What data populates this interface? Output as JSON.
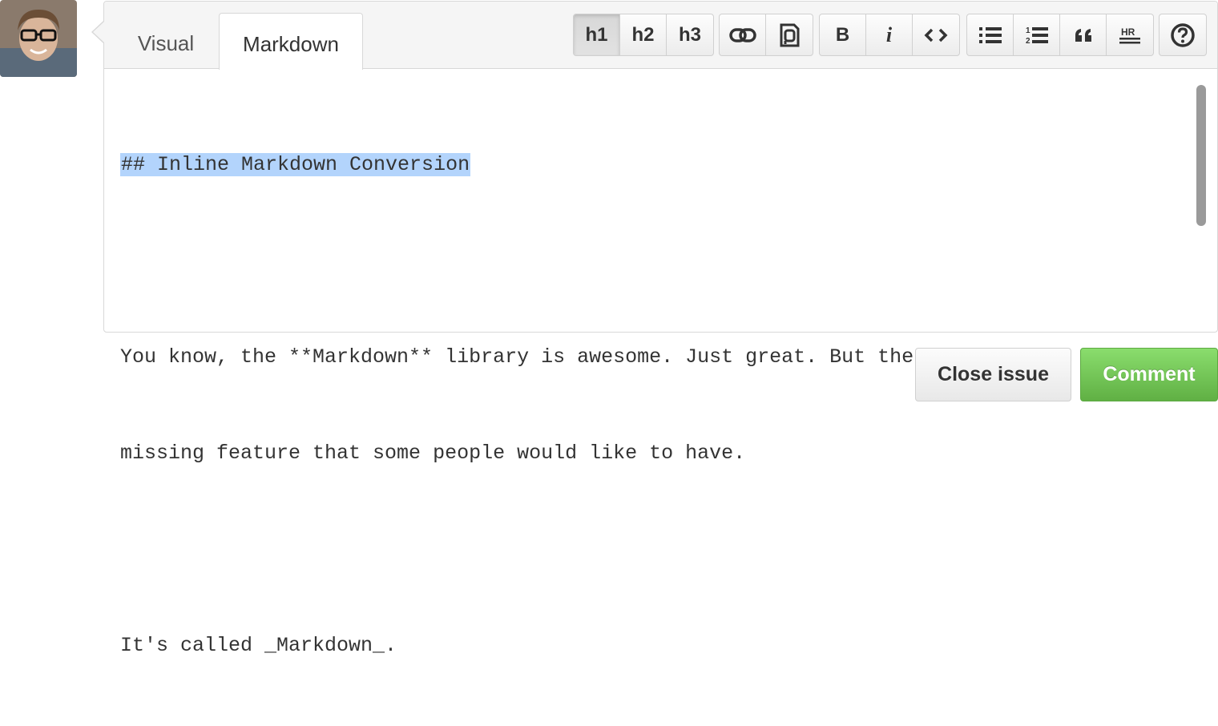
{
  "tabs": {
    "visual": "Visual",
    "markdown": "Markdown"
  },
  "toolbar": {
    "h1": "h1",
    "h2": "h2",
    "h3": "h3",
    "bold": "B",
    "italic": "i",
    "active": "h1"
  },
  "editor": {
    "lines": [
      "## Inline Markdown Conversion",
      "",
      "You know, the **Markdown** library is awesome. Just great. But there is a",
      "missing feature that some people would like to have.",
      "",
      "It's called _Markdown_."
    ],
    "selection_color": "#b3d4fc"
  },
  "actions": {
    "close_issue": "Close issue",
    "comment": "Comment"
  },
  "colors": {
    "comment_button": "#6cc644",
    "border": "#d8d8d8"
  },
  "icons": [
    "link-icon",
    "mention-icon",
    "code-icon",
    "unordered-list-icon",
    "ordered-list-icon",
    "quote-icon",
    "horizontal-rule-icon",
    "help-icon"
  ]
}
